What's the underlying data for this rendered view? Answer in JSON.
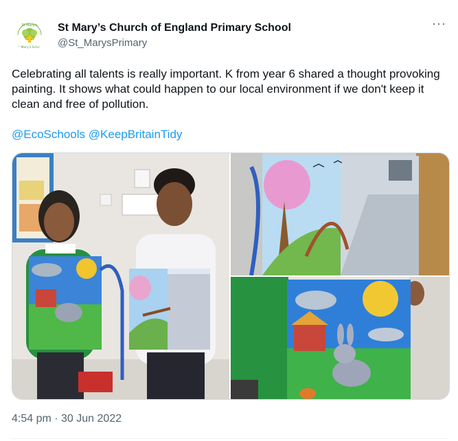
{
  "tweet": {
    "author_name": "St Mary’s Church of England Primary School",
    "author_handle": "@St_MarysPrimary",
    "more_label": "···",
    "text": "Celebrating all talents is really important. K from year 6 shared a thought provoking painting. It shows what could happen to our local environment if we don't keep it clean and free of pollution.",
    "mentions": [
      "@EcoSchools",
      "@KeepBritainTidy"
    ],
    "timestamp": "4:54 pm · 30 Jun 2022"
  },
  "logo": {
    "top_text": "St Mary's",
    "bottom_text": "St Mary's School"
  },
  "colors": {
    "link": "#1d9bf0",
    "text": "#0f1419",
    "secondary": "#536471"
  }
}
